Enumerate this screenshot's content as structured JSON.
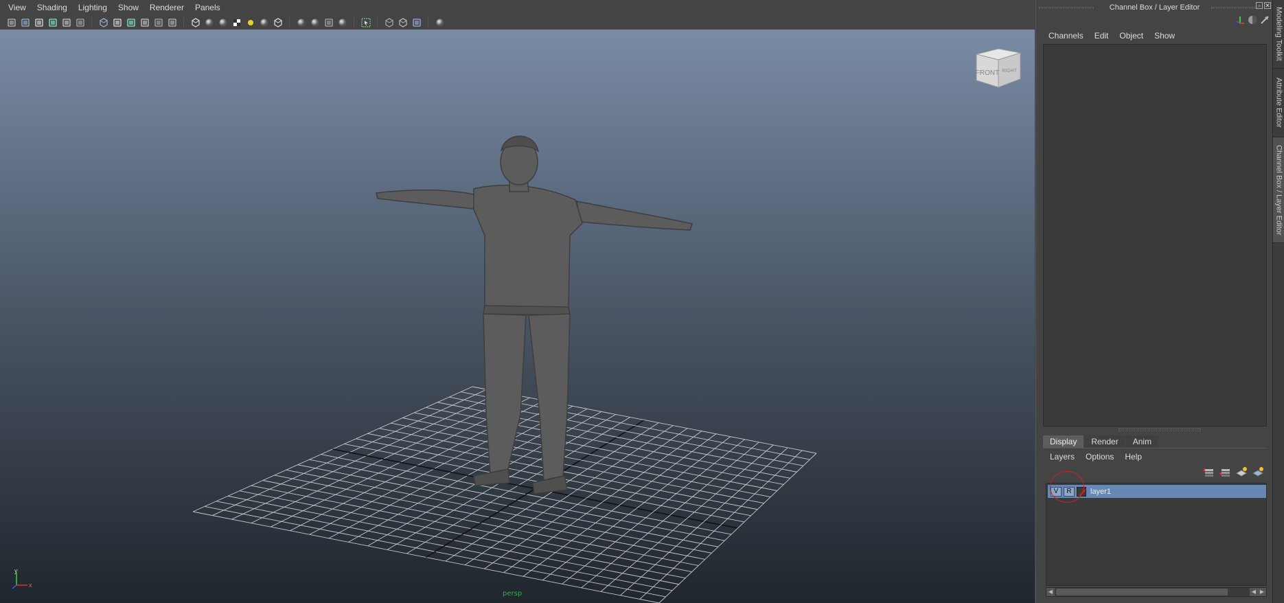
{
  "viewport": {
    "menu": [
      "View",
      "Shading",
      "Lighting",
      "Show",
      "Renderer",
      "Panels"
    ],
    "toolbar_icons": [
      [
        "camera-select-icon",
        "camera-attributes-icon",
        "bookmark-icon",
        "image-plane-icon",
        "2d-pan-zoom-icon",
        "grease-pencil-icon"
      ],
      [
        "grid-icon",
        "film-gate-icon",
        "resolution-gate-icon",
        "gate-mask-icon",
        "field-chart-icon",
        "safe-action-icon"
      ],
      [
        "wireframe-icon",
        "smooth-shade-icon",
        "wireframe-on-shaded-icon",
        "textured-icon",
        "default-lighting-icon",
        "shadows-icon",
        "xray-icon"
      ],
      [
        "ambient-occlusion-icon",
        "motion-blur-icon",
        "multisample-aa-icon",
        "depth-of-field-icon"
      ],
      [
        "isolate-select-icon"
      ],
      [
        "xray-active-components-icon",
        "xray-joints-icon",
        "hud-icon"
      ],
      [
        "hypershade-icon"
      ]
    ],
    "viewcube": {
      "front": "FRONT",
      "right": "RIGHT"
    },
    "axis": {
      "x": "x",
      "y": "y"
    },
    "camera_label": "persp"
  },
  "channel_box": {
    "title": "Channel Box / Layer Editor",
    "menu": [
      "Channels",
      "Edit",
      "Object",
      "Show"
    ]
  },
  "layer_editor": {
    "tabs": [
      "Display",
      "Render",
      "Anim"
    ],
    "active_tab": "Display",
    "menu": [
      "Layers",
      "Options",
      "Help"
    ],
    "layers": [
      {
        "visible": "V",
        "reference": "R",
        "name": "layer1"
      }
    ]
  },
  "side_tabs": [
    "Modeling Toolkit",
    "Attribute Editor",
    "Channel Box / Layer Editor"
  ],
  "colors": {
    "scene_top": "#7a8ba5",
    "scene_bottom": "#20262d",
    "layer_selected": "#6688b3",
    "annotation": "#cc2222",
    "camera_label": "#2fae4f"
  }
}
